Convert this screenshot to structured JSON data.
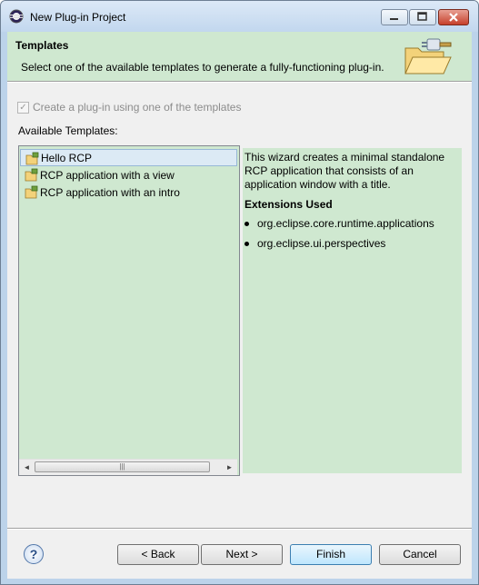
{
  "window": {
    "title": "New Plug-in Project",
    "minimize_symbol": "▁",
    "maximize_symbol": "▭",
    "close_symbol": "✕"
  },
  "banner": {
    "title": "Templates",
    "description": "Select one of the available templates to generate a fully-functioning plug-in.",
    "icon": "wizard-folder-plugin-icon"
  },
  "checkbox": {
    "label": "Create a plug-in using one of the templates",
    "checked": true,
    "enabled": false,
    "check_glyph": "✓"
  },
  "templates": {
    "label": "Available Templates:",
    "items": [
      {
        "label": "Hello RCP",
        "selected": true
      },
      {
        "label": "RCP application with a view",
        "selected": false
      },
      {
        "label": "RCP application with an intro",
        "selected": false
      }
    ],
    "scroll_left_symbol": "◄",
    "scroll_right_symbol": "►",
    "scroll_grip": "|||"
  },
  "description": {
    "text": "This wizard creates a minimal standalone RCP application that consists of an application window with a title.",
    "extensions_heading": "Extensions Used",
    "extensions": [
      "org.eclipse.core.runtime.applications",
      "org.eclipse.ui.perspectives"
    ]
  },
  "buttons": {
    "help_symbol": "?",
    "back": "< Back",
    "next": "Next >",
    "finish": "Finish",
    "cancel": "Cancel"
  },
  "colors": {
    "banner_bg": "#cfe8d0",
    "selection": "#dceaf5",
    "default_button": "#3c7fb1"
  }
}
